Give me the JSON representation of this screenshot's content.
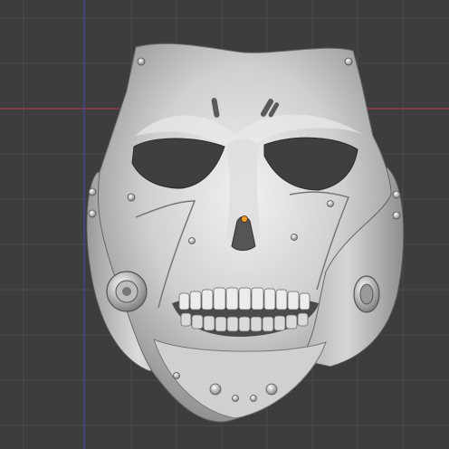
{
  "viewport": {
    "view": "3D Viewport",
    "background_color": "#3d3d3d",
    "grid_color": "#4a4a4a",
    "x_axis_color": "#9b3f4a",
    "z_axis_color": "#4549a3"
  },
  "object": {
    "name": "skull-mask-mesh",
    "shading": "solid-matcap",
    "base_color": "#d8d8d8",
    "origin_color": "#f39c2b"
  }
}
